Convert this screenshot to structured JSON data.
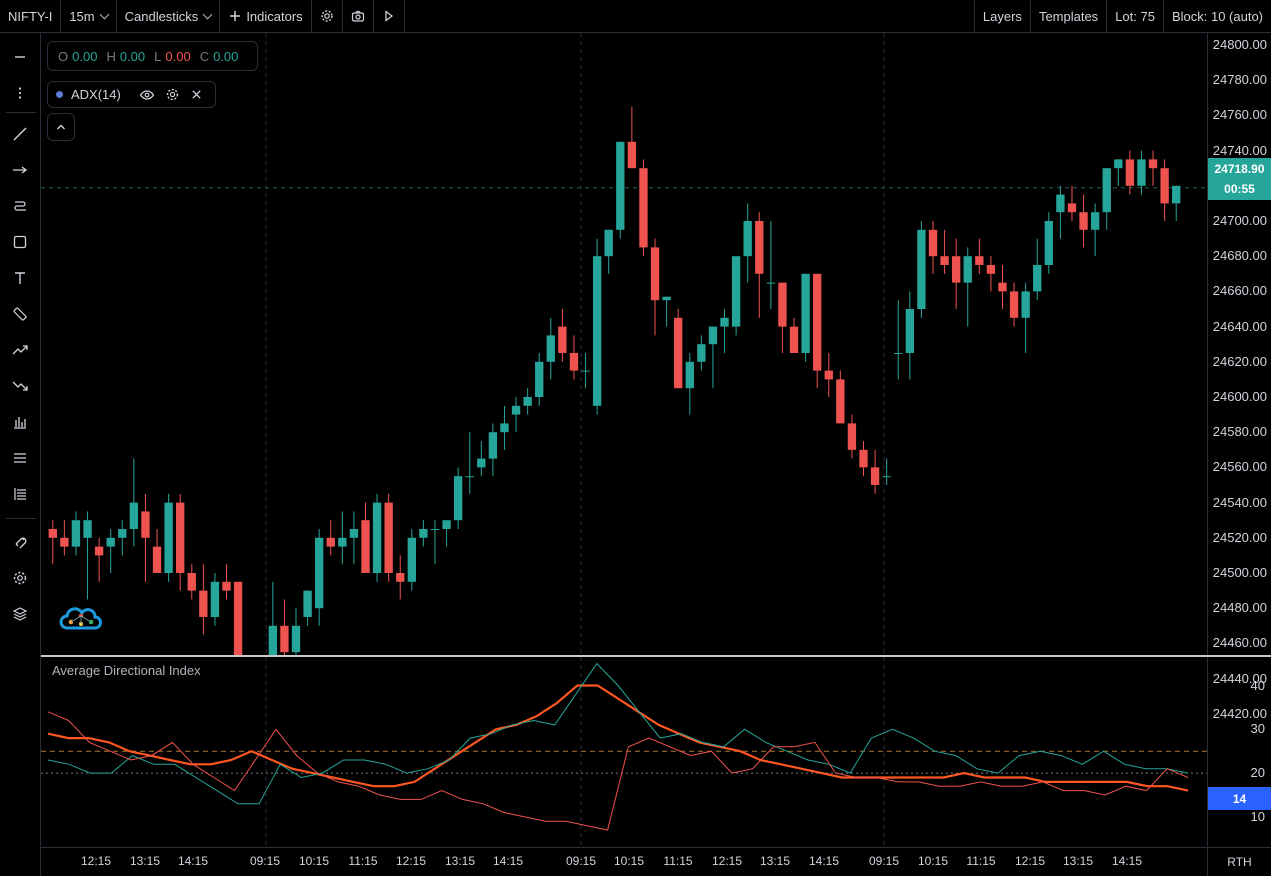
{
  "toolbar": {
    "symbol": "NIFTY-I",
    "interval": "15m",
    "chart_type": "Candlesticks",
    "indicators": "Indicators",
    "layers": "Layers",
    "templates": "Templates",
    "lot": "Lot: 75",
    "block": "Block: 10 (auto)"
  },
  "legend": {
    "o_label": "O",
    "o_value": "0.00",
    "h_label": "H",
    "h_value": "0.00",
    "l_label": "L",
    "l_value": "0.00",
    "c_label": "C",
    "c_value": "0.00",
    "indicator": "ADX(14)"
  },
  "indicator_pane": {
    "title": "Average Directional Index",
    "current_value": "14",
    "y_ticks": [
      "40",
      "30",
      "20",
      "10"
    ]
  },
  "price_axis": {
    "ticks": [
      "24800.00",
      "24780.00",
      "24760.00",
      "24740.00",
      "24720.00",
      "24700.00",
      "24680.00",
      "24660.00",
      "24640.00",
      "24620.00",
      "24600.00",
      "24580.00",
      "24560.00",
      "24540.00",
      "24520.00",
      "24500.00",
      "24480.00",
      "24460.00",
      "24440.00",
      "24420.00"
    ],
    "last_price": "24718.90",
    "countdown": "00:55"
  },
  "time_axis": {
    "labels": [
      "12:15",
      "13:15",
      "14:15",
      "09:15",
      "10:15",
      "11:15",
      "12:15",
      "13:15",
      "14:15",
      "09:15",
      "10:15",
      "11:15",
      "12:15",
      "13:15",
      "14:15",
      "09:15",
      "10:15",
      "11:15",
      "12:15",
      "13:15",
      "14:15"
    ]
  },
  "session_label": "RTH",
  "colors": {
    "up": "#26a69a",
    "down": "#ef5350",
    "adx": "#ff5722",
    "di_plus": "#26a69a",
    "di_minus": "#ef5350",
    "background": "#000000"
  },
  "chart_data": [
    {
      "type": "candlestick",
      "ylim": [
        24410,
        24810
      ],
      "candles": [
        [
          24525,
          24530,
          24505,
          24520
        ],
        [
          24520,
          24530,
          24510,
          24515
        ],
        [
          24515,
          24535,
          24510,
          24530
        ],
        [
          24520,
          24535,
          24485,
          24530
        ],
        [
          24515,
          24520,
          24495,
          24510
        ],
        [
          24515,
          24525,
          24500,
          24520
        ],
        [
          24520,
          24530,
          24510,
          24525
        ],
        [
          24525,
          24565,
          24515,
          24540
        ],
        [
          24535,
          24545,
          24495,
          24520
        ],
        [
          24515,
          24525,
          24500,
          24500
        ],
        [
          24500,
          24545,
          24495,
          24540
        ],
        [
          24540,
          24545,
          24490,
          24500
        ],
        [
          24500,
          24505,
          24485,
          24490
        ],
        [
          24490,
          24505,
          24465,
          24475
        ],
        [
          24475,
          24500,
          24470,
          24495
        ],
        [
          24495,
          24505,
          24485,
          24490
        ],
        [
          24495,
          24495,
          24415,
          24425
        ],
        [
          24425,
          24445,
          24420,
          24427
        ],
        [
          24427,
          24430,
          24427,
          24430
        ],
        [
          24450,
          24495,
          24410,
          24470
        ],
        [
          24470,
          24485,
          24440,
          24455
        ],
        [
          24455,
          24480,
          24430,
          24470
        ],
        [
          24475,
          24490,
          24470,
          24490
        ],
        [
          24480,
          24525,
          24470,
          24520
        ],
        [
          24520,
          24530,
          24510,
          24515
        ],
        [
          24515,
          24535,
          24505,
          24520
        ],
        [
          24520,
          24535,
          24505,
          24525
        ],
        [
          24530,
          24540,
          24500,
          24500
        ],
        [
          24500,
          24545,
          24495,
          24540
        ],
        [
          24540,
          24545,
          24495,
          24500
        ],
        [
          24500,
          24510,
          24485,
          24495
        ],
        [
          24495,
          24525,
          24490,
          24520
        ],
        [
          24520,
          24530,
          24515,
          24525
        ],
        [
          24525,
          24530,
          24505,
          24525
        ],
        [
          24525,
          24530,
          24515,
          24530
        ],
        [
          24530,
          24560,
          24525,
          24555
        ],
        [
          24555,
          24580,
          24545,
          24555
        ],
        [
          24560,
          24575,
          24555,
          24565
        ],
        [
          24565,
          24585,
          24555,
          24580
        ],
        [
          24580,
          24595,
          24570,
          24585
        ],
        [
          24590,
          24600,
          24580,
          24595
        ],
        [
          24595,
          24605,
          24590,
          24600
        ],
        [
          24600,
          24625,
          24595,
          24620
        ],
        [
          24620,
          24645,
          24610,
          24635
        ],
        [
          24640,
          24650,
          24620,
          24625
        ],
        [
          24625,
          24635,
          24610,
          24615
        ],
        [
          24615,
          24625,
          24605,
          24615
        ],
        [
          24595,
          24690,
          24590,
          24680
        ],
        [
          24680,
          24695,
          24670,
          24695
        ],
        [
          24695,
          24745,
          24690,
          24745
        ],
        [
          24745,
          24765,
          24735,
          24730
        ],
        [
          24730,
          24735,
          24680,
          24685
        ],
        [
          24685,
          24690,
          24635,
          24655
        ],
        [
          24655,
          24655,
          24640,
          24657
        ],
        [
          24645,
          24650,
          24605,
          24605
        ],
        [
          24605,
          24625,
          24590,
          24620
        ],
        [
          24620,
          24635,
          24615,
          24630
        ],
        [
          24630,
          24640,
          24605,
          24640
        ],
        [
          24640,
          24650,
          24625,
          24645
        ],
        [
          24640,
          24680,
          24635,
          24680
        ],
        [
          24680,
          24710,
          24665,
          24700
        ],
        [
          24700,
          24705,
          24645,
          24670
        ],
        [
          24665,
          24700,
          24650,
          24665
        ],
        [
          24665,
          24665,
          24625,
          24640
        ],
        [
          24640,
          24645,
          24625,
          24625
        ],
        [
          24625,
          24670,
          24620,
          24670
        ],
        [
          24670,
          24670,
          24605,
          24615
        ],
        [
          24615,
          24625,
          24600,
          24610
        ],
        [
          24610,
          24615,
          24585,
          24585
        ],
        [
          24585,
          24590,
          24565,
          24570
        ],
        [
          24570,
          24575,
          24555,
          24560
        ],
        [
          24560,
          24570,
          24545,
          24550
        ],
        [
          24555,
          24565,
          24550,
          24555
        ],
        [
          24625,
          24655,
          24610,
          24625
        ],
        [
          24625,
          24660,
          24610,
          24650
        ],
        [
          24650,
          24700,
          24645,
          24695
        ],
        [
          24695,
          24700,
          24670,
          24680
        ],
        [
          24680,
          24695,
          24670,
          24675
        ],
        [
          24680,
          24690,
          24650,
          24665
        ],
        [
          24665,
          24685,
          24640,
          24680
        ],
        [
          24680,
          24690,
          24670,
          24675
        ],
        [
          24675,
          24680,
          24660,
          24670
        ],
        [
          24665,
          24675,
          24650,
          24660
        ],
        [
          24660,
          24665,
          24640,
          24645
        ],
        [
          24645,
          24665,
          24625,
          24660
        ],
        [
          24660,
          24690,
          24655,
          24675
        ],
        [
          24675,
          24705,
          24670,
          24700
        ],
        [
          24705,
          24720,
          24690,
          24715
        ],
        [
          24710,
          24720,
          24700,
          24705
        ],
        [
          24705,
          24715,
          24685,
          24695
        ],
        [
          24695,
          24710,
          24680,
          24705
        ],
        [
          24705,
          24730,
          24695,
          24730
        ],
        [
          24730,
          24735,
          24720,
          24735
        ],
        [
          24735,
          24740,
          24715,
          24720
        ],
        [
          24720,
          24740,
          24715,
          24735
        ],
        [
          24735,
          24740,
          24720,
          24730
        ],
        [
          24730,
          24735,
          24700,
          24710
        ],
        [
          24710,
          24720,
          24700,
          24720
        ]
      ],
      "last_price": 24718.9
    },
    {
      "type": "line",
      "title": "Average Directional Index",
      "ylim": [
        5,
        45
      ],
      "reference_lines": [
        25,
        20
      ],
      "series": [
        {
          "color": "#ff5722",
          "values": [
            29,
            28,
            28,
            27,
            25,
            24,
            23,
            22,
            22,
            23,
            25,
            23,
            21,
            20,
            19,
            18,
            17,
            17,
            18,
            21,
            24,
            27,
            30,
            31,
            33,
            36,
            40,
            40,
            37,
            34,
            31,
            29,
            27,
            26,
            25,
            23,
            22,
            21,
            20,
            19,
            19,
            19,
            19,
            19,
            19,
            20,
            19,
            19,
            19,
            18,
            18,
            18,
            18,
            18,
            17,
            17,
            16
          ]
        },
        {
          "color": "#26a69a",
          "values": [
            23,
            22,
            20,
            20,
            24,
            22,
            22,
            19,
            16,
            13,
            13,
            22,
            19,
            20,
            23,
            23,
            22,
            20,
            21,
            23,
            28,
            29,
            31,
            32,
            31,
            38,
            45,
            40,
            34,
            28,
            29,
            27,
            26,
            30,
            27,
            25,
            23,
            22,
            20,
            28,
            30,
            28,
            25,
            24,
            21,
            20,
            24,
            25,
            24,
            22,
            25,
            22,
            21,
            21,
            20
          ]
        },
        {
          "color": "#ef5350",
          "values": [
            34,
            32,
            27,
            25,
            23,
            24,
            27,
            22,
            19,
            16,
            23,
            30,
            24,
            20,
            18,
            17,
            15,
            14,
            14,
            16,
            14,
            13,
            11,
            10,
            9,
            9,
            8,
            7,
            26,
            28,
            26,
            24,
            25,
            20,
            21,
            26,
            26,
            27,
            20,
            19,
            19,
            18,
            18,
            17,
            17,
            18,
            17,
            17,
            18,
            16,
            16,
            15,
            17,
            16,
            21,
            19
          ]
        }
      ]
    }
  ]
}
